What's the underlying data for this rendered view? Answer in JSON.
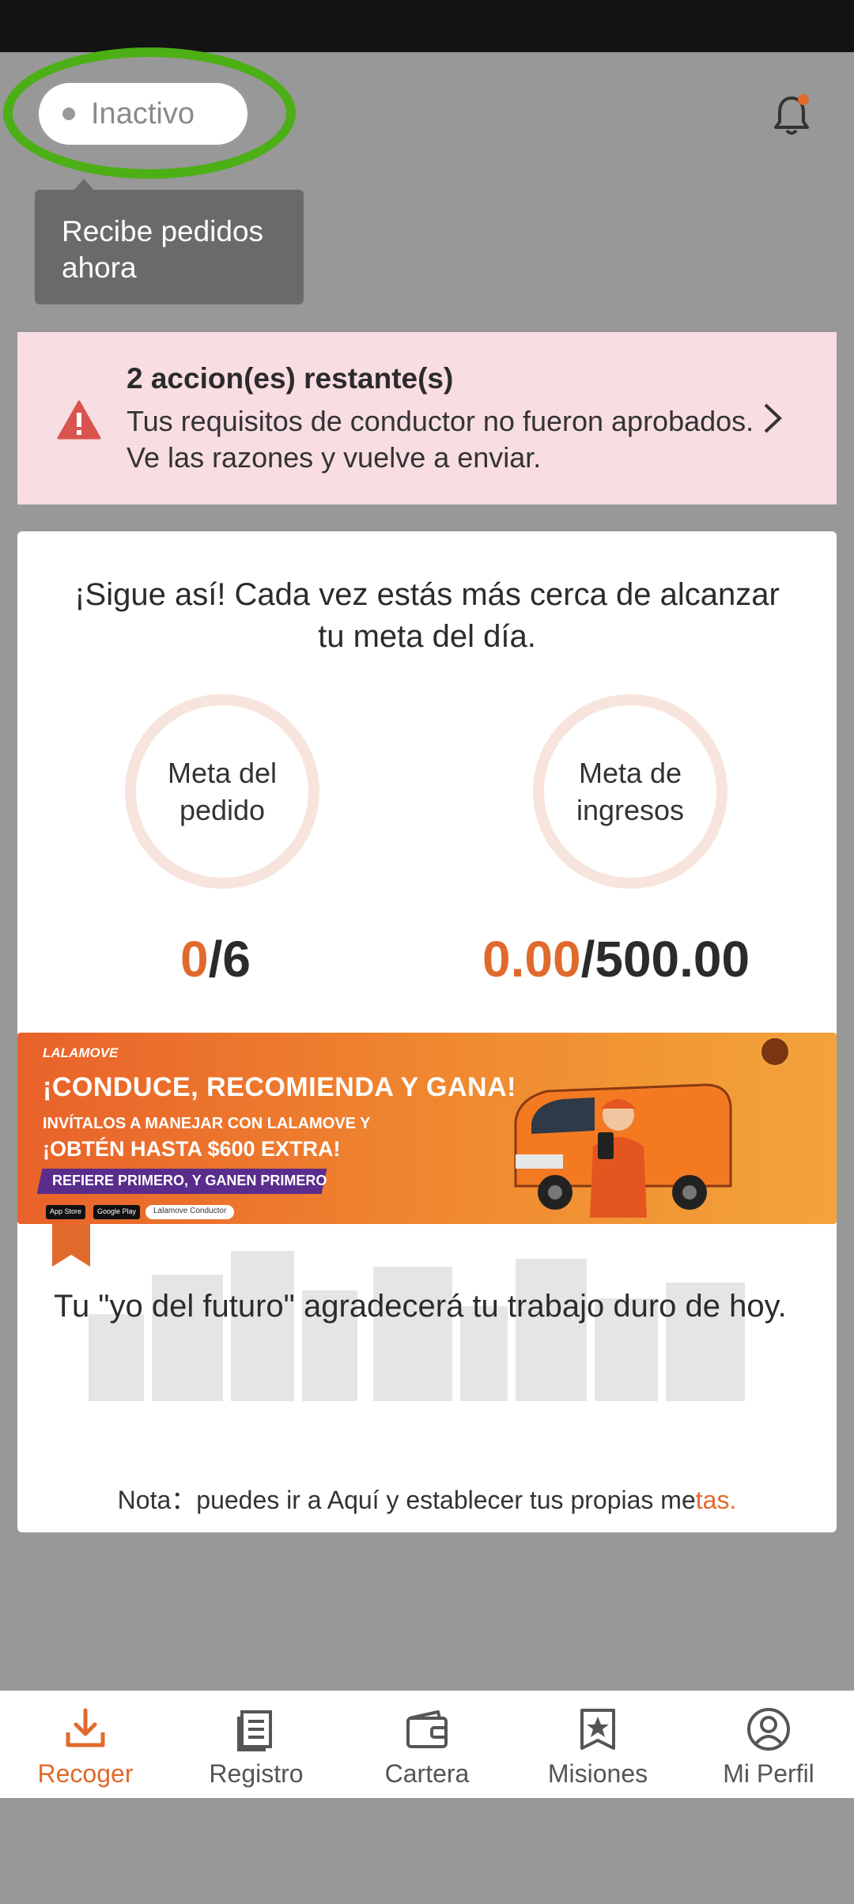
{
  "header": {
    "status_label": "Inactivo",
    "tooltip_text": "Recibe pedidos ahora"
  },
  "alert": {
    "title": "2 accion(es) restante(s)",
    "body": "Tus requisitos de conductor no fueron aprobados. Ve las razones y vuelve a enviar."
  },
  "goals": {
    "headline": "¡Sigue así! Cada vez estás más cerca de alcanzar tu meta del día.",
    "order": {
      "label_line1": "Meta del",
      "label_line2": "pedido",
      "current": "0",
      "total": "/6"
    },
    "income": {
      "label_line1": "Meta de",
      "label_line2": "ingresos",
      "current": "0.00",
      "total": "/500.00"
    }
  },
  "banner": {
    "brand": "LALAMOVE",
    "title": "¡CONDUCE, RECOMIENDA Y GANA!",
    "sub1": "INVÍTALOS A MANEJAR CON LALAMOVE Y",
    "sub2": "¡OBTÉN HASTA $600 EXTRA!",
    "ribbon": "REFIERE PRIMERO, Y GANEN PRIMERO",
    "app_store": "App Store",
    "google_play": "Google Play",
    "search_term": "Lalamove Conductor"
  },
  "motto": "Tu \"yo del futuro\" agradecerá tu trabajo duro de hoy.",
  "note": {
    "prefix": "Nota：puedes ir a Aquí y establecer tus propias me",
    "accent": "tas."
  },
  "nav": {
    "items": [
      {
        "label": "Recoger",
        "icon": "download-tray-icon"
      },
      {
        "label": "Registro",
        "icon": "document-list-icon"
      },
      {
        "label": "Cartera",
        "icon": "wallet-icon"
      },
      {
        "label": "Misiones",
        "icon": "star-badge-icon"
      },
      {
        "label": "Mi Perfil",
        "icon": "user-circle-icon"
      }
    ]
  },
  "colors": {
    "accent": "#e06a2c",
    "highlight": "#4caf16",
    "alert_bg": "#f8dde2",
    "tooltip_bg": "#6a6a6a"
  }
}
